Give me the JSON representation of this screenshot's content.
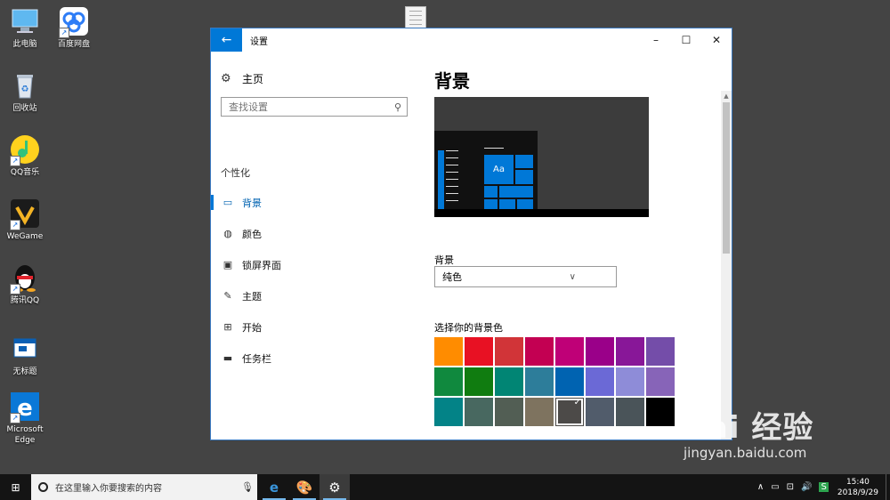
{
  "desktop": {
    "icons": [
      {
        "label": "此电脑"
      },
      {
        "label": "百度网盘"
      },
      {
        "label": "回收站"
      },
      {
        "label": "QQ音乐"
      },
      {
        "label": "WeGame"
      },
      {
        "label": "腾讯QQ"
      },
      {
        "label": "无标题"
      },
      {
        "label": "Microsoft Edge"
      }
    ]
  },
  "window": {
    "title": "设置",
    "back_icon": "←",
    "minimize_icon": "–",
    "maximize_icon": "☐",
    "close_icon": "✕"
  },
  "sidebar": {
    "home_label": "主页",
    "search_placeholder": "查找设置",
    "section_title": "个性化",
    "items": [
      {
        "label": "背景",
        "icon": "picture-icon",
        "selected": true
      },
      {
        "label": "颜色",
        "icon": "palette-icon",
        "selected": false
      },
      {
        "label": "锁屏界面",
        "icon": "lock-screen-icon",
        "selected": false
      },
      {
        "label": "主题",
        "icon": "theme-brush-icon",
        "selected": false
      },
      {
        "label": "开始",
        "icon": "start-grid-icon",
        "selected": false
      },
      {
        "label": "任务栏",
        "icon": "taskbar-icon",
        "selected": false
      }
    ]
  },
  "main": {
    "title": "背景",
    "preview_sample": "Aa",
    "background_label": "背景",
    "background_value": "纯色",
    "color_label": "选择你的背景色",
    "swatches": [
      "#ff8c00",
      "#e81123",
      "#d13438",
      "#c30052",
      "#bf0077",
      "#9a0089",
      "#881798",
      "#744da9",
      "#10893e",
      "#107c10",
      "#018574",
      "#2d7d9a",
      "#0063b1",
      "#6b69d6",
      "#8e8cd8",
      "#8764b8",
      "#038387",
      "#486860",
      "#525e54",
      "#7e735f",
      "#4c4a48",
      "#515c6b",
      "#4a5459",
      "#000000"
    ],
    "selected_swatch_index": 20
  },
  "taskbar": {
    "search_placeholder": "在这里输入你要搜索的内容",
    "time": "15:40",
    "date": "2018/9/29"
  },
  "watermark": {
    "brand": "Bai 经验",
    "url": "jingyan.baidu.com"
  }
}
